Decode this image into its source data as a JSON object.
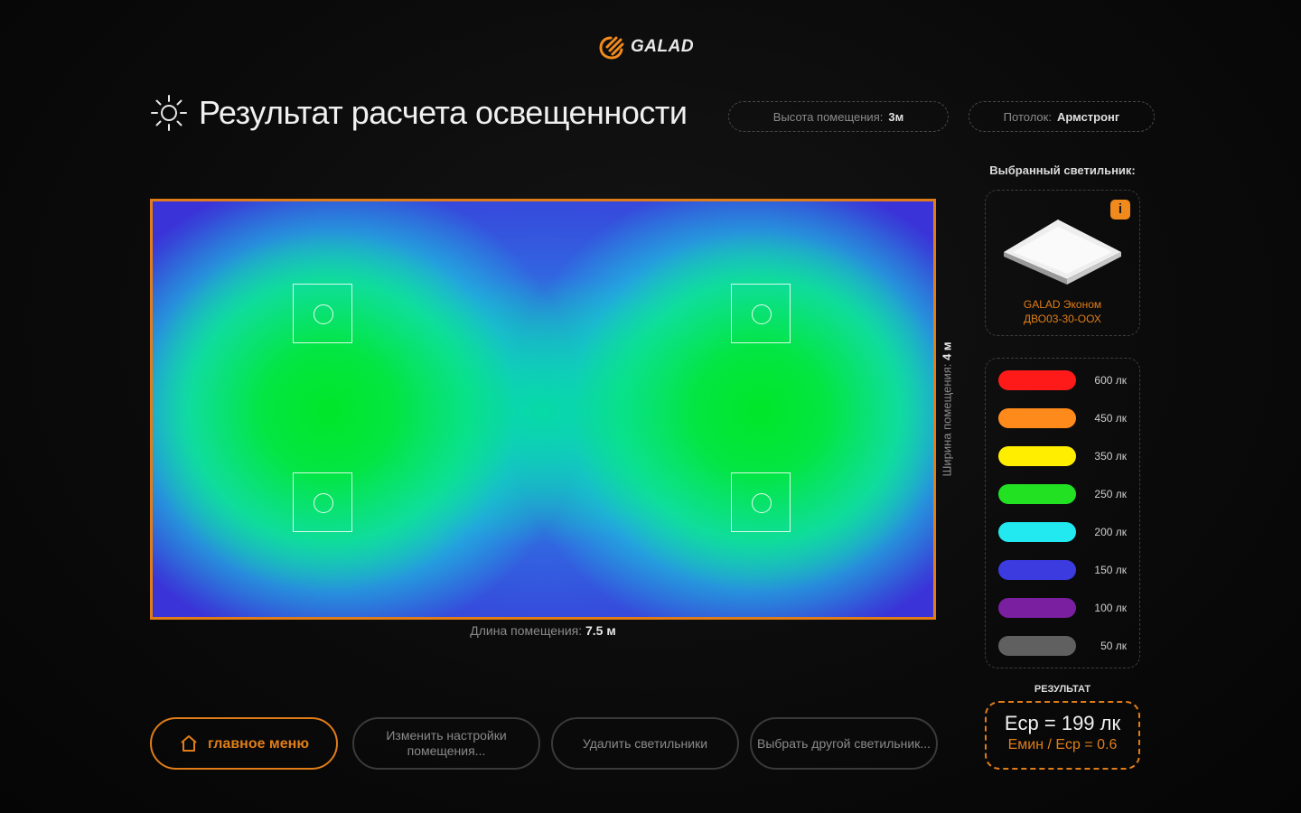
{
  "header": {
    "brand": "GALAD",
    "title": "Результат расчета освещенности"
  },
  "room_info": {
    "height_label": "Высота помещения:",
    "height_value": "3м",
    "ceiling_label": "Потолок:",
    "ceiling_value": "Армстронг"
  },
  "heatmap": {
    "length_label": "Длина помещения:",
    "length_value": "7.5 м",
    "width_label": "Ширина помещения:",
    "width_value": "4 м"
  },
  "luminaire": {
    "section_label": "Выбранный светильник:",
    "info_badge": "i",
    "name_line1": "GALAD Эконом",
    "name_line2": "ДВО03-30-ООХ"
  },
  "legend": [
    {
      "label": "600 лк",
      "color": "#ff1a1a"
    },
    {
      "label": "450 лк",
      "color": "#ff8a1c"
    },
    {
      "label": "350 лк",
      "color": "#ffee00"
    },
    {
      "label": "250 лк",
      "color": "#22e022"
    },
    {
      "label": "200 лк",
      "color": "#22e8f0"
    },
    {
      "label": "150 лк",
      "color": "#3b3be0"
    },
    {
      "label": "100 лк",
      "color": "#7a1fa0"
    },
    {
      "label": "50 лк",
      "color": "#606060"
    }
  ],
  "result": {
    "section_label": "РЕЗУЛЬТАТ",
    "avg_line": "Eср = 199 лк",
    "ratio_line": "Eмин / Eср = 0.6"
  },
  "buttons": {
    "main_menu": "главное меню",
    "edit_room": "Изменить настройки помещения...",
    "delete_luminaires": "Удалить светильники",
    "choose_other": "Выбрать другой светильник..."
  },
  "colors": {
    "accent": "#e07d18"
  }
}
